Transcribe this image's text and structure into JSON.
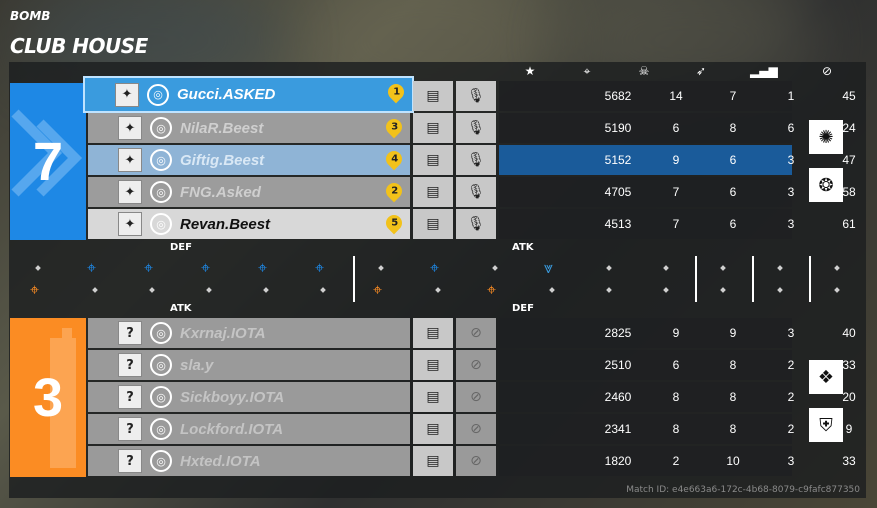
{
  "header": {
    "mode": "BOMB",
    "map": "CLUB HOUSE"
  },
  "columns": [
    "star-icon",
    "crosshair-icon",
    "skull-icon",
    "assist-icon",
    "signal-icon",
    "ban-icon"
  ],
  "colors": {
    "blue": "#1e88e5",
    "orange": "#fb8c23",
    "highlight_blue": "#3a9bde",
    "selected_blue": "#1a5b9a"
  },
  "blue_team": {
    "score": "7",
    "players": [
      {
        "name": "Gucci.ASKED",
        "rank": "1",
        "score": "5682",
        "kills": "14",
        "deaths": "7",
        "assists": "1",
        "ping": "45",
        "state": "self"
      },
      {
        "name": "NilaR.Beest",
        "rank": "3",
        "score": "5190",
        "kills": "6",
        "deaths": "8",
        "assists": "6",
        "ping": "24",
        "state": "dead"
      },
      {
        "name": "Giftig.Beest",
        "rank": "4",
        "score": "5152",
        "kills": "9",
        "deaths": "6",
        "assists": "3",
        "ping": "47",
        "state": "selected"
      },
      {
        "name": "FNG.Asked",
        "rank": "2",
        "score": "4705",
        "kills": "7",
        "deaths": "6",
        "assists": "3",
        "ping": "58",
        "state": "dead"
      },
      {
        "name": "Revan.Beest",
        "rank": "5",
        "score": "4513",
        "kills": "7",
        "deaths": "6",
        "assists": "3",
        "ping": "61",
        "state": "alive"
      }
    ]
  },
  "orange_team": {
    "score": "3",
    "players": [
      {
        "name": "Kxrnaj.IOTA",
        "score": "2825",
        "kills": "9",
        "deaths": "9",
        "assists": "3",
        "ping": "40"
      },
      {
        "name": "sla.y",
        "score": "2510",
        "kills": "6",
        "deaths": "8",
        "assists": "2",
        "ping": "33"
      },
      {
        "name": "Sickboyy.IOTA",
        "score": "2460",
        "kills": "8",
        "deaths": "8",
        "assists": "2",
        "ping": "20"
      },
      {
        "name": "Lockford.IOTA",
        "score": "2341",
        "kills": "8",
        "deaths": "8",
        "assists": "2",
        "ping": "9"
      },
      {
        "name": "Hxted.IOTA",
        "score": "1820",
        "kills": "2",
        "deaths": "10",
        "assists": "3",
        "ping": "33"
      }
    ]
  },
  "timeline": {
    "label_def_top": "DEF",
    "label_atk_top": "ATK",
    "label_atk_bottom": "ATK",
    "label_def_bottom": "DEF"
  },
  "footer": {
    "match_id": "Match ID: e4e663a6-172c-4b68-8079-c9fafc877350"
  }
}
